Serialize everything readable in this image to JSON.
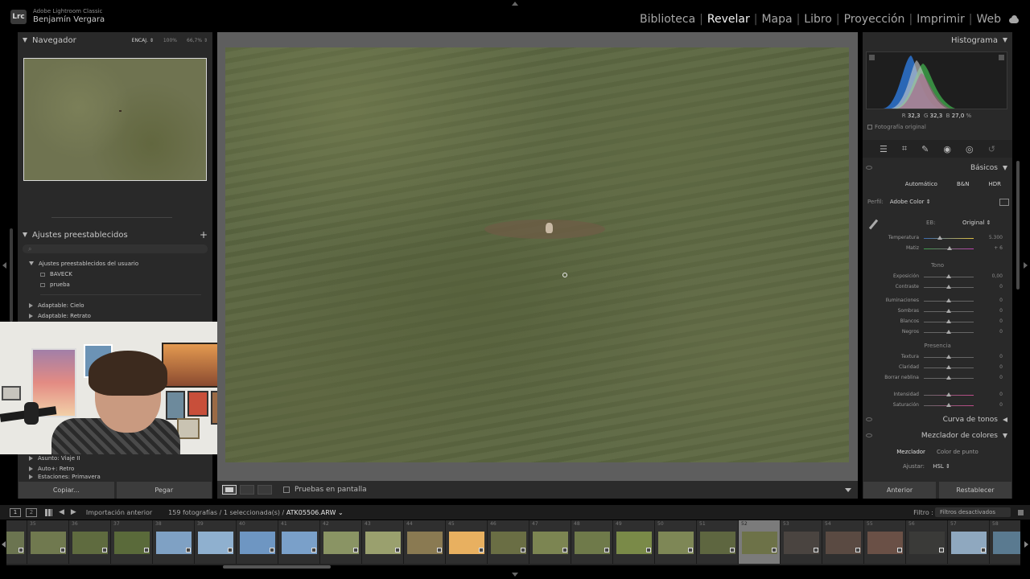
{
  "app": {
    "logo": "Lrc",
    "name": "Adobe Lightroom Classic",
    "user": "Benjamín Vergara"
  },
  "modules": [
    "Biblioteca",
    "Revelar",
    "Mapa",
    "Libro",
    "Proyección",
    "Imprimir",
    "Web"
  ],
  "active_module": "Revelar",
  "navigator": {
    "title": "Navegador",
    "zoom_options": [
      "ENCAJ. ⇕",
      "100%",
      "66,7% ⇕"
    ]
  },
  "presets": {
    "title": "Ajustes preestablecidos",
    "user_group": "Ajustes preestablecidos del usuario",
    "user_items": [
      "BAVECK",
      "prueba"
    ],
    "groups_top": [
      "Adaptable: Cielo",
      "Adaptable: Retrato"
    ],
    "groups_bottom": [
      "Asunto: Viaje II",
      "Auto+: Retro",
      "Estaciones: Primavera"
    ]
  },
  "left_buttons": {
    "copy": "Copiar...",
    "paste": "Pegar"
  },
  "toolbar": {
    "soft_proof": "Pruebas en pantalla"
  },
  "histogram": {
    "title": "Histograma",
    "r_label": "R",
    "r": "32,3",
    "g_label": "G",
    "g": "32,3",
    "b_label": "B",
    "b": "27,0",
    "unit": "%",
    "original_photo": "Fotografía original"
  },
  "basic": {
    "title": "Básicos",
    "treatments": [
      "Automático",
      "B&N",
      "HDR"
    ],
    "profile_label": "Perfil:",
    "profile_value": "Adobe Color ⇕",
    "wb_label": "EB:",
    "wb_value": "Original ⇕",
    "sliders_wb": [
      {
        "label": "Temperatura",
        "value": "5.300",
        "pos": 0.33
      },
      {
        "label": "Matiz",
        "value": "+ 6",
        "pos": 0.52
      }
    ],
    "tone_title": "Tono",
    "sliders_tone_1": [
      {
        "label": "Exposición",
        "value": "0,00",
        "pos": 0.5
      },
      {
        "label": "Contraste",
        "value": "0",
        "pos": 0.5
      }
    ],
    "sliders_tone_2": [
      {
        "label": "Iluminaciones",
        "value": "0",
        "pos": 0.5
      },
      {
        "label": "Sombras",
        "value": "0",
        "pos": 0.5
      },
      {
        "label": "Blancos",
        "value": "0",
        "pos": 0.5
      },
      {
        "label": "Negros",
        "value": "0",
        "pos": 0.5
      }
    ],
    "presence_title": "Presencia",
    "sliders_presence": [
      {
        "label": "Textura",
        "value": "0",
        "pos": 0.5
      },
      {
        "label": "Claridad",
        "value": "0",
        "pos": 0.5
      },
      {
        "label": "Borrar neblina",
        "value": "0",
        "pos": 0.5
      }
    ],
    "sliders_color": [
      {
        "label": "Intensidad",
        "value": "0",
        "pos": 0.5
      },
      {
        "label": "Saturación",
        "value": "0",
        "pos": 0.5
      }
    ]
  },
  "tone_curve": {
    "title": "Curva de tonos"
  },
  "color_mixer": {
    "title": "Mezclador de colores",
    "tabs": [
      "Mezclador",
      "Color de punto"
    ],
    "adjust_label": "Ajustar:",
    "adjust_value": "HSL ⇕"
  },
  "right_buttons": {
    "previous": "Anterior",
    "reset": "Restablecer"
  },
  "filmstrip_bar": {
    "screen1": "1",
    "screen2": "2",
    "source": "Importación anterior",
    "count": "159 fotografías / 1 seleccionada(s) /",
    "filename": "ATK05506.ARW ⌄",
    "filter_label": "Filtro :",
    "filter_value": "Filtros desactivados"
  },
  "filmstrip": [
    {
      "num": "",
      "color": "#6b7450"
    },
    {
      "num": "35",
      "color": "#70794f"
    },
    {
      "num": "36",
      "color": "#5f6b3f"
    },
    {
      "num": "37",
      "color": "#5a6a3a"
    },
    {
      "num": "38",
      "color": "#7fa1c4"
    },
    {
      "num": "39",
      "color": "#8fb0cf"
    },
    {
      "num": "40",
      "color": "#6e96c2"
    },
    {
      "num": "41",
      "color": "#7aa0c9"
    },
    {
      "num": "42",
      "color": "#8a9464"
    },
    {
      "num": "43",
      "color": "#9aa06e"
    },
    {
      "num": "44",
      "color": "#8a7a52"
    },
    {
      "num": "45",
      "color": "#e8b060"
    },
    {
      "num": "46",
      "color": "#6a6e44"
    },
    {
      "num": "47",
      "color": "#7c8552"
    },
    {
      "num": "48",
      "color": "#6f7a4a"
    },
    {
      "num": "49",
      "color": "#7a8a48"
    },
    {
      "num": "50",
      "color": "#7e8756"
    },
    {
      "num": "51",
      "color": "#5e6640"
    },
    {
      "num": "52",
      "color": "#6d7248"
    },
    {
      "num": "53",
      "color": "#4a4440"
    },
    {
      "num": "54",
      "color": "#5a4a42"
    },
    {
      "num": "55",
      "color": "#6a5046"
    },
    {
      "num": "56",
      "color": "#3a3a38"
    },
    {
      "num": "57",
      "color": "#8fa8bf"
    },
    {
      "num": "58",
      "color": "#5a7a90"
    }
  ],
  "selected_index": 18
}
